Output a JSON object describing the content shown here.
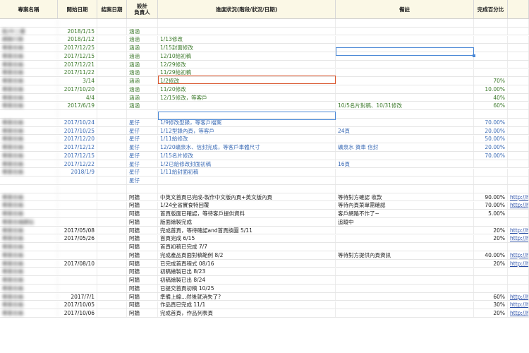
{
  "headers": {
    "name": "專案名稱",
    "start": "開始日期",
    "end": "結案日期",
    "designer": "設計\n負責人",
    "progress": "進度狀況(階段/狀況/日期)",
    "notes": "備註",
    "percent": "完成百分比"
  },
  "rows": [
    {
      "group": "green",
      "name": "",
      "start": "",
      "end": "",
      "designer": "",
      "progress": "",
      "notes": "",
      "percent": "",
      "link": ""
    },
    {
      "group": "green",
      "name": "凱/中二樓",
      "start": "2018/1/15",
      "end": "",
      "designer": "涵涵",
      "progress": "",
      "notes": "",
      "percent": "",
      "link": ""
    },
    {
      "group": "green",
      "name": "網路行銷",
      "start": "2018/1/12",
      "end": "",
      "designer": "涵涵",
      "progress": "1/13修改",
      "notes": "",
      "percent": "",
      "link": ""
    },
    {
      "group": "green",
      "name": "專案名稱",
      "start": "2017/12/25",
      "end": "",
      "designer": "涵涵",
      "progress": "1/15封面修改",
      "notes": "",
      "percent": "",
      "link": ""
    },
    {
      "group": "green",
      "name": "專案名稱",
      "start": "2017/12/15",
      "end": "",
      "designer": "涵涵",
      "progress": "12/10給初稿",
      "notes": "",
      "percent": "",
      "link": ""
    },
    {
      "group": "green",
      "name": "專案名稱",
      "start": "2017/12/21",
      "end": "",
      "designer": "涵涵",
      "progress": "12/29修改",
      "notes": "",
      "percent": "",
      "link": ""
    },
    {
      "group": "green",
      "name": "專案名稱",
      "start": "2017/11/22",
      "end": "",
      "designer": "涵涵",
      "progress": "11/29給初稿",
      "notes": "",
      "percent": "",
      "link": ""
    },
    {
      "group": "green",
      "name": "專案名稱",
      "start": "3/14",
      "end": "",
      "designer": "涵涵",
      "progress": "1/2修改",
      "notes": "",
      "percent": "70%",
      "link": ""
    },
    {
      "group": "green",
      "name": "專案名稱",
      "start": "2017/10/20",
      "end": "",
      "designer": "涵涵",
      "progress": "11/20修改",
      "notes": "",
      "percent": "10.00%",
      "link": ""
    },
    {
      "group": "green",
      "name": "專案名稱",
      "start": "4/4",
      "end": "",
      "designer": "涵涵",
      "progress": "12/15修改，等客戶",
      "notes": "",
      "percent": "40%",
      "link": ""
    },
    {
      "group": "green",
      "name": "專案名稱",
      "start": "2017/6/19",
      "end": "",
      "designer": "涵涵",
      "progress": "",
      "notes": "10/5名片對稿、10/31修改",
      "percent": "60%",
      "link": ""
    },
    {
      "group": "green",
      "name": "",
      "start": "",
      "end": "",
      "designer": "",
      "progress": "",
      "notes": "",
      "percent": "",
      "link": ""
    },
    {
      "group": "blue",
      "name": "專案名稱",
      "start": "2017/10/24",
      "end": "",
      "designer": "星仔",
      "progress": "1/9修改型錄，等客戶檔案",
      "notes": "",
      "percent": "70.00%",
      "link": ""
    },
    {
      "group": "blue",
      "name": "專案名稱",
      "start": "2017/10/25",
      "end": "",
      "designer": "星仔",
      "progress": "1/12型錄內頁，等客戶",
      "notes": "24頁",
      "percent": "20.00%",
      "link": ""
    },
    {
      "group": "blue",
      "name": "專案名稱",
      "start": "2017/12/20",
      "end": "",
      "designer": "星仔",
      "progress": "1/11給修改",
      "notes": "",
      "percent": "50.00%",
      "link": ""
    },
    {
      "group": "blue",
      "name": "專案名稱",
      "start": "2017/12/12",
      "end": "",
      "designer": "星仔",
      "progress": "12/20礦泉水、信封完成，等客戶車體尺寸",
      "notes": "礦泉水 資車 信封",
      "percent": "20.00%",
      "link": ""
    },
    {
      "group": "blue",
      "name": "專案名稱",
      "start": "2017/12/15",
      "end": "",
      "designer": "星仔",
      "progress": "1/15名片修改",
      "notes": "",
      "percent": "70.00%",
      "link": ""
    },
    {
      "group": "blue",
      "name": "專案名稱",
      "start": "2017/12/22",
      "end": "",
      "designer": "星仔",
      "progress": "1/2已給修改封面初稿",
      "notes": "16頁",
      "percent": "",
      "link": ""
    },
    {
      "group": "blue",
      "name": "專案名稱",
      "start": "2018/1/9",
      "end": "",
      "designer": "星仔",
      "progress": "1/11給封面初稿",
      "notes": "",
      "percent": "",
      "link": ""
    },
    {
      "group": "blue",
      "name": "",
      "start": "",
      "end": "",
      "designer": "星仔",
      "progress": "",
      "notes": "",
      "percent": "",
      "link": ""
    },
    {
      "group": "black",
      "name": "",
      "start": "",
      "end": "",
      "designer": "",
      "progress": "",
      "notes": "",
      "percent": "",
      "link": ""
    },
    {
      "group": "black",
      "name": "專案名稱",
      "start": "",
      "end": "",
      "designer": "阿牆",
      "progress": "中英文首頁已完成-製作中文版內頁+英文版內頁",
      "notes": "等待對方確認 收款",
      "percent": "90.00%",
      "link": "http://h"
    },
    {
      "group": "black",
      "name": "專案名稱",
      "start": "",
      "end": "",
      "designer": "阿牆",
      "progress": "1/24全省實食特回覆",
      "notes": "等待內頁菜單需確認",
      "percent": "70.00%",
      "link": "http://h"
    },
    {
      "group": "black",
      "name": "專案名稱",
      "start": "",
      "end": "",
      "designer": "阿牆",
      "progress": "首頁版面已確認，等待客戶提供資料",
      "notes": "客戶網路不作了~",
      "percent": "5.00%",
      "link": ""
    },
    {
      "group": "black",
      "name": "專案名稱網站",
      "start": "",
      "end": "",
      "designer": "阿牆",
      "progress": "版面繪製完成",
      "notes": "追蹤中",
      "percent": "",
      "link": ""
    },
    {
      "group": "black",
      "name": "專案名稱",
      "start": "2017/05/08",
      "end": "",
      "designer": "阿牆",
      "progress": "完成首頁，等待確認and首頁換圖 5/11",
      "notes": "",
      "percent": "20%",
      "link": "http://hc"
    },
    {
      "group": "black",
      "name": "專案名稱",
      "start": "2017/05/26",
      "end": "",
      "designer": "阿牆",
      "progress": "首頁完成 6/15",
      "notes": "",
      "percent": "20%",
      "link": "http://hc"
    },
    {
      "group": "black",
      "name": "專案名稱",
      "start": "",
      "end": "",
      "designer": "阿牆",
      "progress": "首頁初稿已完成 7/7",
      "notes": "",
      "percent": "",
      "link": ""
    },
    {
      "group": "black",
      "name": "專案名稱",
      "start": "",
      "end": "",
      "designer": "阿牆",
      "progress": "完成產品頁面對稿範例 8/2",
      "notes": "等待對方提供內頁資訊",
      "percent": "40.00%",
      "link": "http://h"
    },
    {
      "group": "black",
      "name": "專案名稱",
      "start": "2017/08/10",
      "end": "",
      "designer": "阿牆",
      "progress": "已完成首頁程式 08/16",
      "notes": "",
      "percent": "20%",
      "link": "http://hc"
    },
    {
      "group": "black",
      "name": "專案名稱",
      "start": "",
      "end": "",
      "designer": "阿牆",
      "progress": "初稿繪製已出 8/23",
      "notes": "",
      "percent": "",
      "link": ""
    },
    {
      "group": "black",
      "name": "專案名稱",
      "start": "",
      "end": "",
      "designer": "阿牆",
      "progress": "初稿繪製已出 8/24",
      "notes": "",
      "percent": "",
      "link": ""
    },
    {
      "group": "black",
      "name": "專案名稱",
      "start": "",
      "end": "",
      "designer": "阿牆",
      "progress": "已提交首頁初稿 10/25",
      "notes": "",
      "percent": "",
      "link": ""
    },
    {
      "group": "black",
      "name": "專案名稱",
      "start": "2017/7/1",
      "end": "",
      "designer": "阿牆",
      "progress": "準備上線...然後就消失了?",
      "notes": "",
      "percent": "60%",
      "link": "http://hc"
    },
    {
      "group": "black",
      "name": "專案名稱",
      "start": "2017/10/05",
      "end": "",
      "designer": "阿牆",
      "progress": "作品頁已完成 11/1",
      "notes": "",
      "percent": "30%",
      "link": "http://hc"
    },
    {
      "group": "black",
      "name": "專案名稱",
      "start": "2017/10/06",
      "end": "",
      "designer": "阿牆",
      "progress": "完成首頁，作品列表頁",
      "notes": "",
      "percent": "20%",
      "link": "http://hc"
    }
  ]
}
